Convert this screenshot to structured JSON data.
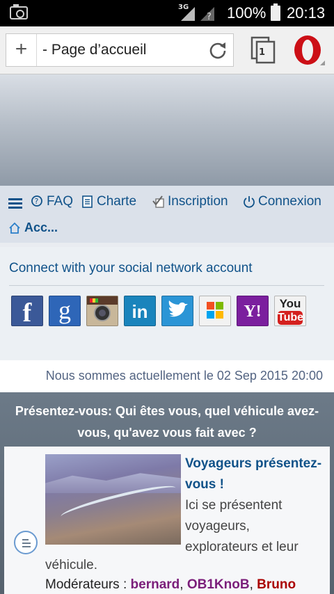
{
  "status_bar": {
    "network": "3G",
    "battery": "100%",
    "time": "20:13"
  },
  "browser": {
    "new_tab_label": "+",
    "page_title": "- Page d’accueil",
    "tab_count": "1"
  },
  "nav": {
    "faq": "FAQ",
    "charte": "Charte",
    "inscription": "Inscription",
    "connexion": "Connexion",
    "breadcrumb": "Acc..."
  },
  "social": {
    "heading": "Connect with your social network account",
    "networks": [
      "facebook",
      "google",
      "instagram",
      "linkedin",
      "twitter",
      "windows-live",
      "yahoo",
      "youtube"
    ],
    "labels": {
      "facebook": "f",
      "google": "g",
      "linkedin": "in",
      "yahoo": "Y!",
      "youtube_top": "You",
      "youtube_bottom": "Tube"
    }
  },
  "date_line": "Nous sommes actuellement le  02 Sep 2015 20:00",
  "category": {
    "title": "Présentez-vous: Qui êtes vous, quel véhicule avez-vous, qu'avez vous fait avec ?"
  },
  "forum": {
    "name": "Voyageurs présentez-vous !",
    "description_part1": "Ici se présentent voyageurs, explorateurs et leur",
    "description_part2": "véhicule.",
    "moderators_label": "Modérateurs :",
    "moderators": [
      "bernard",
      "OB1KnoB",
      "Bruno"
    ]
  },
  "colors": {
    "link": "#105289",
    "nav_bg": "#dbe1ea",
    "category_bg": "#62707e"
  }
}
